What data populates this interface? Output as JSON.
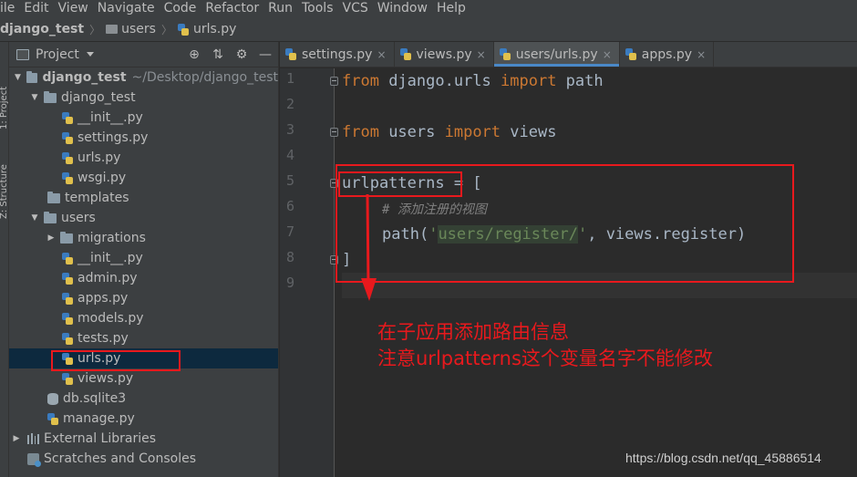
{
  "menu": [
    "ile",
    "Edit",
    "View",
    "Navigate",
    "Code",
    "Refactor",
    "Run",
    "Tools",
    "VCS",
    "Window",
    "Help"
  ],
  "breadcrumb": [
    "django_test",
    "users",
    "urls.py"
  ],
  "side_tabs": [
    "1: Project",
    "Z: Structure"
  ],
  "project_panel": {
    "title": "Project",
    "tools": [
      "⊕",
      "⇅",
      "⚙",
      "—"
    ]
  },
  "tree": [
    {
      "label": "django_test",
      "suffix": "~/Desktop/django_test",
      "type": "project-folder",
      "arrow": "down"
    },
    {
      "label": "django_test",
      "type": "folder",
      "arrow": "down"
    },
    {
      "label": "__init__.py",
      "type": "py"
    },
    {
      "label": "settings.py",
      "type": "py"
    },
    {
      "label": "urls.py",
      "type": "py"
    },
    {
      "label": "wsgi.py",
      "type": "py"
    },
    {
      "label": "templates",
      "type": "folder",
      "arrow": "none"
    },
    {
      "label": "users",
      "type": "folder",
      "arrow": "down"
    },
    {
      "label": "migrations",
      "type": "folder",
      "arrow": "right"
    },
    {
      "label": "__init__.py",
      "type": "py"
    },
    {
      "label": "admin.py",
      "type": "py"
    },
    {
      "label": "apps.py",
      "type": "py"
    },
    {
      "label": "models.py",
      "type": "py"
    },
    {
      "label": "tests.py",
      "type": "py"
    },
    {
      "label": "urls.py",
      "type": "py",
      "selected": true
    },
    {
      "label": "views.py",
      "type": "py"
    },
    {
      "label": "db.sqlite3",
      "type": "db"
    },
    {
      "label": "manage.py",
      "type": "py"
    },
    {
      "label": "External Libraries",
      "type": "lib",
      "arrow": "right"
    },
    {
      "label": "Scratches and Consoles",
      "type": "scratch"
    }
  ],
  "tabs": [
    {
      "label": "settings.py",
      "close": "×"
    },
    {
      "label": "views.py",
      "close": "×"
    },
    {
      "label": "users/urls.py",
      "close": "×",
      "active": true
    },
    {
      "label": "apps.py",
      "close": "×"
    }
  ],
  "line_numbers": [
    "1",
    "2",
    "3",
    "4",
    "5",
    "6",
    "7",
    "8",
    "9"
  ],
  "code": {
    "l1_from": "from",
    "l1_mod": " django.urls ",
    "l1_import": "import",
    "l1_name": " path",
    "l3_from": "from",
    "l3_mod": " users ",
    "l3_import": "import",
    "l3_name": " views",
    "l5_var": "urlpatterns",
    "l5_rest": " = [",
    "l6_comment": "# 添加注册的视图",
    "l7_func": "path(",
    "l7_q1": "'",
    "l7_str": "users/register/",
    "l7_q2": "'",
    "l7_rest": ", views.register)",
    "l8": "]"
  },
  "annotation": {
    "line1": "在子应用添加路由信息",
    "line2": "注意urlpatterns这个变量名字不能修改"
  },
  "watermark": "https://blog.csdn.net/qq_45886514",
  "colors": {
    "annotation_red": "#e8191d",
    "keyword": "#cc7832",
    "string": "#6a8759",
    "comment": "#808080",
    "selection": "#0d293e",
    "tab_accent": "#4a88c7"
  }
}
